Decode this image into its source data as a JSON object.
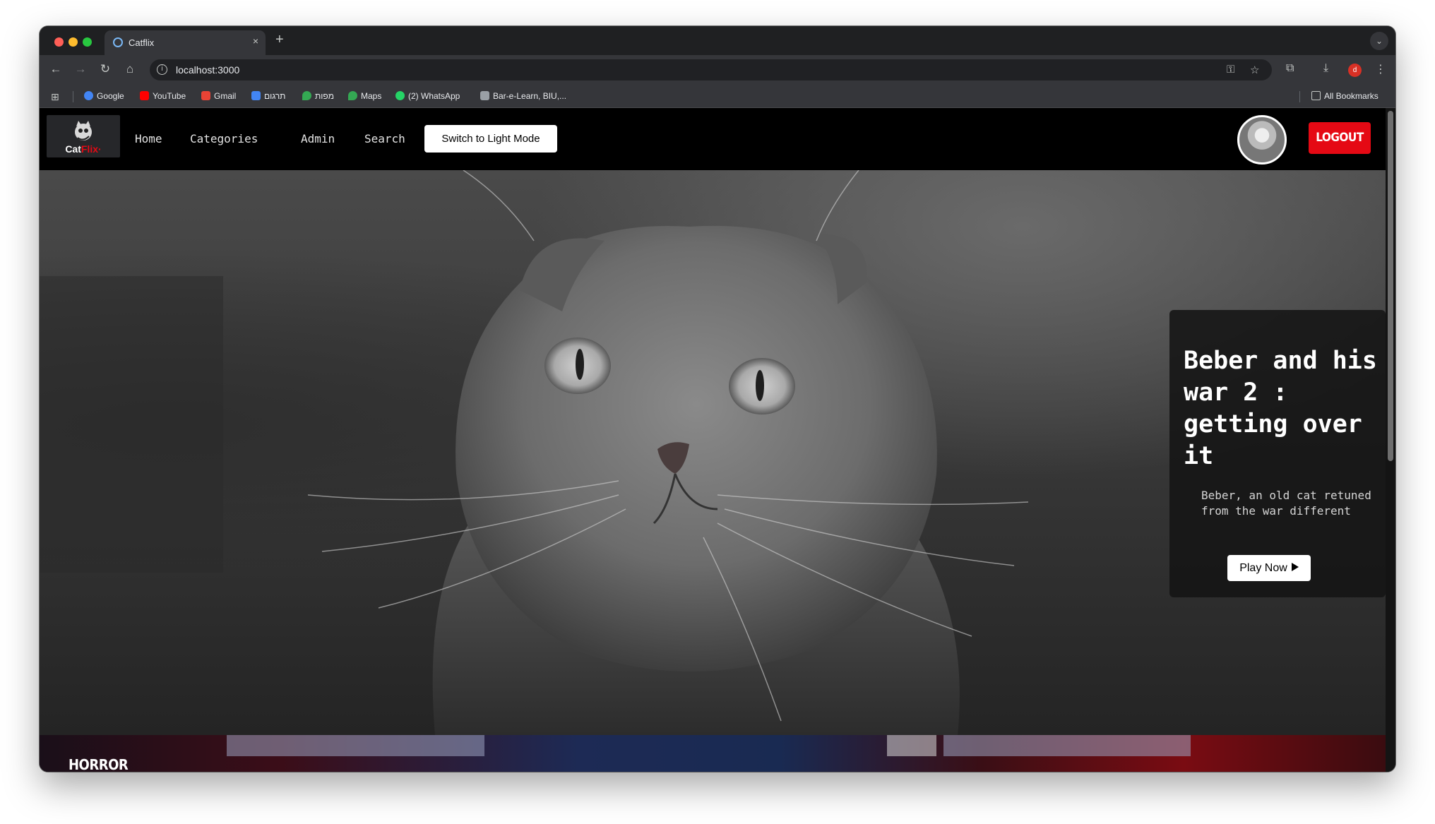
{
  "browser": {
    "tab_title": "Catflix",
    "tab_close": "×",
    "new_tab": "+",
    "url": "localhost:3000",
    "bookmarks": [
      {
        "label": "Google",
        "color": "#4285f4"
      },
      {
        "label": "YouTube",
        "color": "#ff0000"
      },
      {
        "label": "Gmail",
        "color": "#ea4335"
      },
      {
        "label": "תרגום",
        "color": "#4285f4"
      },
      {
        "label": "מפות",
        "color": "#34a853"
      },
      {
        "label": "Maps",
        "color": "#34a853"
      },
      {
        "label": "(2) WhatsApp",
        "color": "#25d366"
      },
      {
        "label": "Bar-e-Learn, BIU,...",
        "color": "#9aa0a6"
      }
    ],
    "all_bookmarks": "All Bookmarks",
    "profile_initial": "d"
  },
  "navbar": {
    "logo": {
      "text_main": "Cat",
      "text_accent": "Flix",
      "text_dot": "·"
    },
    "links": [
      "Home",
      "Categories",
      "Admin",
      "Search"
    ],
    "mode_button": "Switch to Light Mode",
    "logout_button": "LOGOUT"
  },
  "hero": {
    "title": "Beber and his war 2 : getting over it",
    "description": "Beber, an old cat retuned from the war different",
    "play_button": "Play Now"
  },
  "rows": [
    {
      "label": "HORROR"
    }
  ],
  "colors": {
    "accent": "#e50914",
    "background": "#000000"
  }
}
